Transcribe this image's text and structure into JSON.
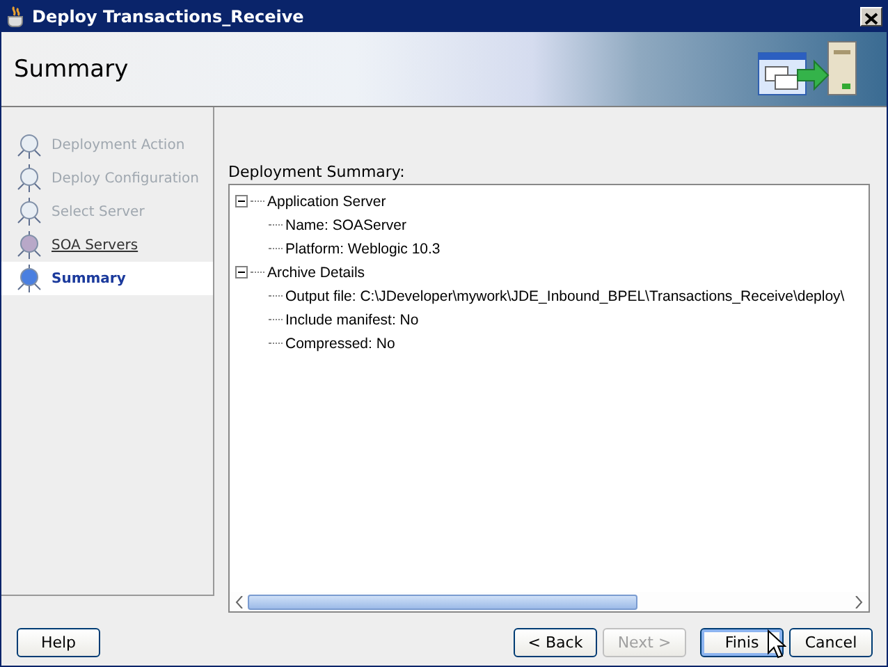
{
  "window": {
    "title": "Deploy Transactions_Receive"
  },
  "header": {
    "title": "Summary"
  },
  "steps": [
    {
      "label": "Deployment Action",
      "disabled": true,
      "selected": false
    },
    {
      "label": "Deploy Configuration",
      "disabled": true,
      "selected": false
    },
    {
      "label": "Select Server",
      "disabled": true,
      "selected": false
    },
    {
      "label": "SOA Servers",
      "disabled": false,
      "selected": false
    },
    {
      "label": "Summary",
      "disabled": false,
      "selected": true
    }
  ],
  "summary": {
    "label": "Deployment Summary:",
    "tree": [
      {
        "label": "Application Server",
        "expanded": true,
        "children": [
          {
            "label": "Name: SOAServer"
          },
          {
            "label": "Platform: Weblogic 10.3"
          }
        ]
      },
      {
        "label": "Archive Details",
        "expanded": true,
        "children": [
          {
            "label": "Output file: C:\\JDeveloper\\mywork\\JDE_Inbound_BPEL\\Transactions_Receive\\deploy\\"
          },
          {
            "label": "Include manifest: No"
          },
          {
            "label": "Compressed: No"
          }
        ]
      }
    ]
  },
  "buttons": [
    {
      "label": "Help",
      "kind": "left",
      "disabled": false,
      "default": false
    },
    {
      "label": "< Back",
      "kind": "right",
      "disabled": false,
      "default": false
    },
    {
      "label": "Next >",
      "kind": "right",
      "disabled": true,
      "default": false
    },
    {
      "label": "Finis",
      "kind": "right",
      "disabled": false,
      "default": true
    },
    {
      "label": "Cancel",
      "kind": "right",
      "disabled": false,
      "default": false
    }
  ]
}
